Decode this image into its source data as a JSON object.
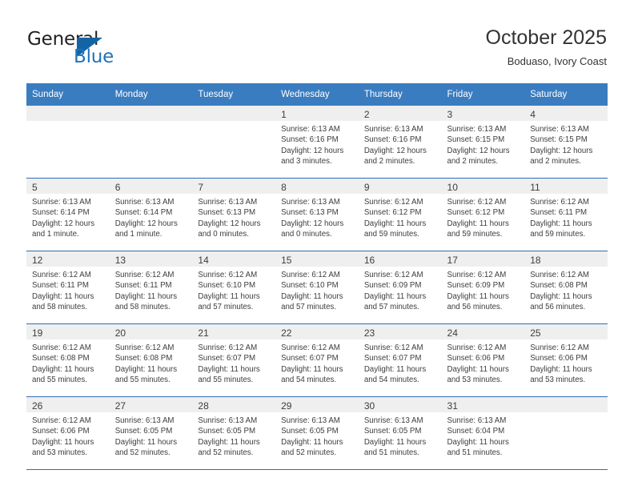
{
  "brand": {
    "name_top": "General",
    "name_bottom": "Blue",
    "accent_color": "#1f72bb",
    "triangle_color": "#1464a5"
  },
  "header": {
    "title": "October 2025",
    "subtitle": "Boduaso, Ivory Coast"
  },
  "theme": {
    "header_row_bg": "#3a7cc0",
    "row_divider": "#2f6fb5",
    "daynum_band_bg": "#efefef",
    "text_color": "#3d3d3d"
  },
  "labels": {
    "sunrise_prefix": "Sunrise:",
    "sunset_prefix": "Sunset:",
    "daylight_prefix": "Daylight:"
  },
  "weekday_headers": [
    "Sunday",
    "Monday",
    "Tuesday",
    "Wednesday",
    "Thursday",
    "Friday",
    "Saturday"
  ],
  "weeks": [
    [
      {
        "day": "",
        "sunrise": "",
        "sunset": "",
        "daylight_line1": "",
        "daylight_line2": ""
      },
      {
        "day": "",
        "sunrise": "",
        "sunset": "",
        "daylight_line1": "",
        "daylight_line2": ""
      },
      {
        "day": "",
        "sunrise": "",
        "sunset": "",
        "daylight_line1": "",
        "daylight_line2": ""
      },
      {
        "day": "1",
        "sunrise": "Sunrise: 6:13 AM",
        "sunset": "Sunset: 6:16 PM",
        "daylight_line1": "Daylight: 12 hours",
        "daylight_line2": "and 3 minutes."
      },
      {
        "day": "2",
        "sunrise": "Sunrise: 6:13 AM",
        "sunset": "Sunset: 6:16 PM",
        "daylight_line1": "Daylight: 12 hours",
        "daylight_line2": "and 2 minutes."
      },
      {
        "day": "3",
        "sunrise": "Sunrise: 6:13 AM",
        "sunset": "Sunset: 6:15 PM",
        "daylight_line1": "Daylight: 12 hours",
        "daylight_line2": "and 2 minutes."
      },
      {
        "day": "4",
        "sunrise": "Sunrise: 6:13 AM",
        "sunset": "Sunset: 6:15 PM",
        "daylight_line1": "Daylight: 12 hours",
        "daylight_line2": "and 2 minutes."
      }
    ],
    [
      {
        "day": "5",
        "sunrise": "Sunrise: 6:13 AM",
        "sunset": "Sunset: 6:14 PM",
        "daylight_line1": "Daylight: 12 hours",
        "daylight_line2": "and 1 minute."
      },
      {
        "day": "6",
        "sunrise": "Sunrise: 6:13 AM",
        "sunset": "Sunset: 6:14 PM",
        "daylight_line1": "Daylight: 12 hours",
        "daylight_line2": "and 1 minute."
      },
      {
        "day": "7",
        "sunrise": "Sunrise: 6:13 AM",
        "sunset": "Sunset: 6:13 PM",
        "daylight_line1": "Daylight: 12 hours",
        "daylight_line2": "and 0 minutes."
      },
      {
        "day": "8",
        "sunrise": "Sunrise: 6:13 AM",
        "sunset": "Sunset: 6:13 PM",
        "daylight_line1": "Daylight: 12 hours",
        "daylight_line2": "and 0 minutes."
      },
      {
        "day": "9",
        "sunrise": "Sunrise: 6:12 AM",
        "sunset": "Sunset: 6:12 PM",
        "daylight_line1": "Daylight: 11 hours",
        "daylight_line2": "and 59 minutes."
      },
      {
        "day": "10",
        "sunrise": "Sunrise: 6:12 AM",
        "sunset": "Sunset: 6:12 PM",
        "daylight_line1": "Daylight: 11 hours",
        "daylight_line2": "and 59 minutes."
      },
      {
        "day": "11",
        "sunrise": "Sunrise: 6:12 AM",
        "sunset": "Sunset: 6:11 PM",
        "daylight_line1": "Daylight: 11 hours",
        "daylight_line2": "and 59 minutes."
      }
    ],
    [
      {
        "day": "12",
        "sunrise": "Sunrise: 6:12 AM",
        "sunset": "Sunset: 6:11 PM",
        "daylight_line1": "Daylight: 11 hours",
        "daylight_line2": "and 58 minutes."
      },
      {
        "day": "13",
        "sunrise": "Sunrise: 6:12 AM",
        "sunset": "Sunset: 6:11 PM",
        "daylight_line1": "Daylight: 11 hours",
        "daylight_line2": "and 58 minutes."
      },
      {
        "day": "14",
        "sunrise": "Sunrise: 6:12 AM",
        "sunset": "Sunset: 6:10 PM",
        "daylight_line1": "Daylight: 11 hours",
        "daylight_line2": "and 57 minutes."
      },
      {
        "day": "15",
        "sunrise": "Sunrise: 6:12 AM",
        "sunset": "Sunset: 6:10 PM",
        "daylight_line1": "Daylight: 11 hours",
        "daylight_line2": "and 57 minutes."
      },
      {
        "day": "16",
        "sunrise": "Sunrise: 6:12 AM",
        "sunset": "Sunset: 6:09 PM",
        "daylight_line1": "Daylight: 11 hours",
        "daylight_line2": "and 57 minutes."
      },
      {
        "day": "17",
        "sunrise": "Sunrise: 6:12 AM",
        "sunset": "Sunset: 6:09 PM",
        "daylight_line1": "Daylight: 11 hours",
        "daylight_line2": "and 56 minutes."
      },
      {
        "day": "18",
        "sunrise": "Sunrise: 6:12 AM",
        "sunset": "Sunset: 6:08 PM",
        "daylight_line1": "Daylight: 11 hours",
        "daylight_line2": "and 56 minutes."
      }
    ],
    [
      {
        "day": "19",
        "sunrise": "Sunrise: 6:12 AM",
        "sunset": "Sunset: 6:08 PM",
        "daylight_line1": "Daylight: 11 hours",
        "daylight_line2": "and 55 minutes."
      },
      {
        "day": "20",
        "sunrise": "Sunrise: 6:12 AM",
        "sunset": "Sunset: 6:08 PM",
        "daylight_line1": "Daylight: 11 hours",
        "daylight_line2": "and 55 minutes."
      },
      {
        "day": "21",
        "sunrise": "Sunrise: 6:12 AM",
        "sunset": "Sunset: 6:07 PM",
        "daylight_line1": "Daylight: 11 hours",
        "daylight_line2": "and 55 minutes."
      },
      {
        "day": "22",
        "sunrise": "Sunrise: 6:12 AM",
        "sunset": "Sunset: 6:07 PM",
        "daylight_line1": "Daylight: 11 hours",
        "daylight_line2": "and 54 minutes."
      },
      {
        "day": "23",
        "sunrise": "Sunrise: 6:12 AM",
        "sunset": "Sunset: 6:07 PM",
        "daylight_line1": "Daylight: 11 hours",
        "daylight_line2": "and 54 minutes."
      },
      {
        "day": "24",
        "sunrise": "Sunrise: 6:12 AM",
        "sunset": "Sunset: 6:06 PM",
        "daylight_line1": "Daylight: 11 hours",
        "daylight_line2": "and 53 minutes."
      },
      {
        "day": "25",
        "sunrise": "Sunrise: 6:12 AM",
        "sunset": "Sunset: 6:06 PM",
        "daylight_line1": "Daylight: 11 hours",
        "daylight_line2": "and 53 minutes."
      }
    ],
    [
      {
        "day": "26",
        "sunrise": "Sunrise: 6:12 AM",
        "sunset": "Sunset: 6:06 PM",
        "daylight_line1": "Daylight: 11 hours",
        "daylight_line2": "and 53 minutes."
      },
      {
        "day": "27",
        "sunrise": "Sunrise: 6:13 AM",
        "sunset": "Sunset: 6:05 PM",
        "daylight_line1": "Daylight: 11 hours",
        "daylight_line2": "and 52 minutes."
      },
      {
        "day": "28",
        "sunrise": "Sunrise: 6:13 AM",
        "sunset": "Sunset: 6:05 PM",
        "daylight_line1": "Daylight: 11 hours",
        "daylight_line2": "and 52 minutes."
      },
      {
        "day": "29",
        "sunrise": "Sunrise: 6:13 AM",
        "sunset": "Sunset: 6:05 PM",
        "daylight_line1": "Daylight: 11 hours",
        "daylight_line2": "and 52 minutes."
      },
      {
        "day": "30",
        "sunrise": "Sunrise: 6:13 AM",
        "sunset": "Sunset: 6:05 PM",
        "daylight_line1": "Daylight: 11 hours",
        "daylight_line2": "and 51 minutes."
      },
      {
        "day": "31",
        "sunrise": "Sunrise: 6:13 AM",
        "sunset": "Sunset: 6:04 PM",
        "daylight_line1": "Daylight: 11 hours",
        "daylight_line2": "and 51 minutes."
      },
      {
        "day": "",
        "sunrise": "",
        "sunset": "",
        "daylight_line1": "",
        "daylight_line2": ""
      }
    ]
  ]
}
